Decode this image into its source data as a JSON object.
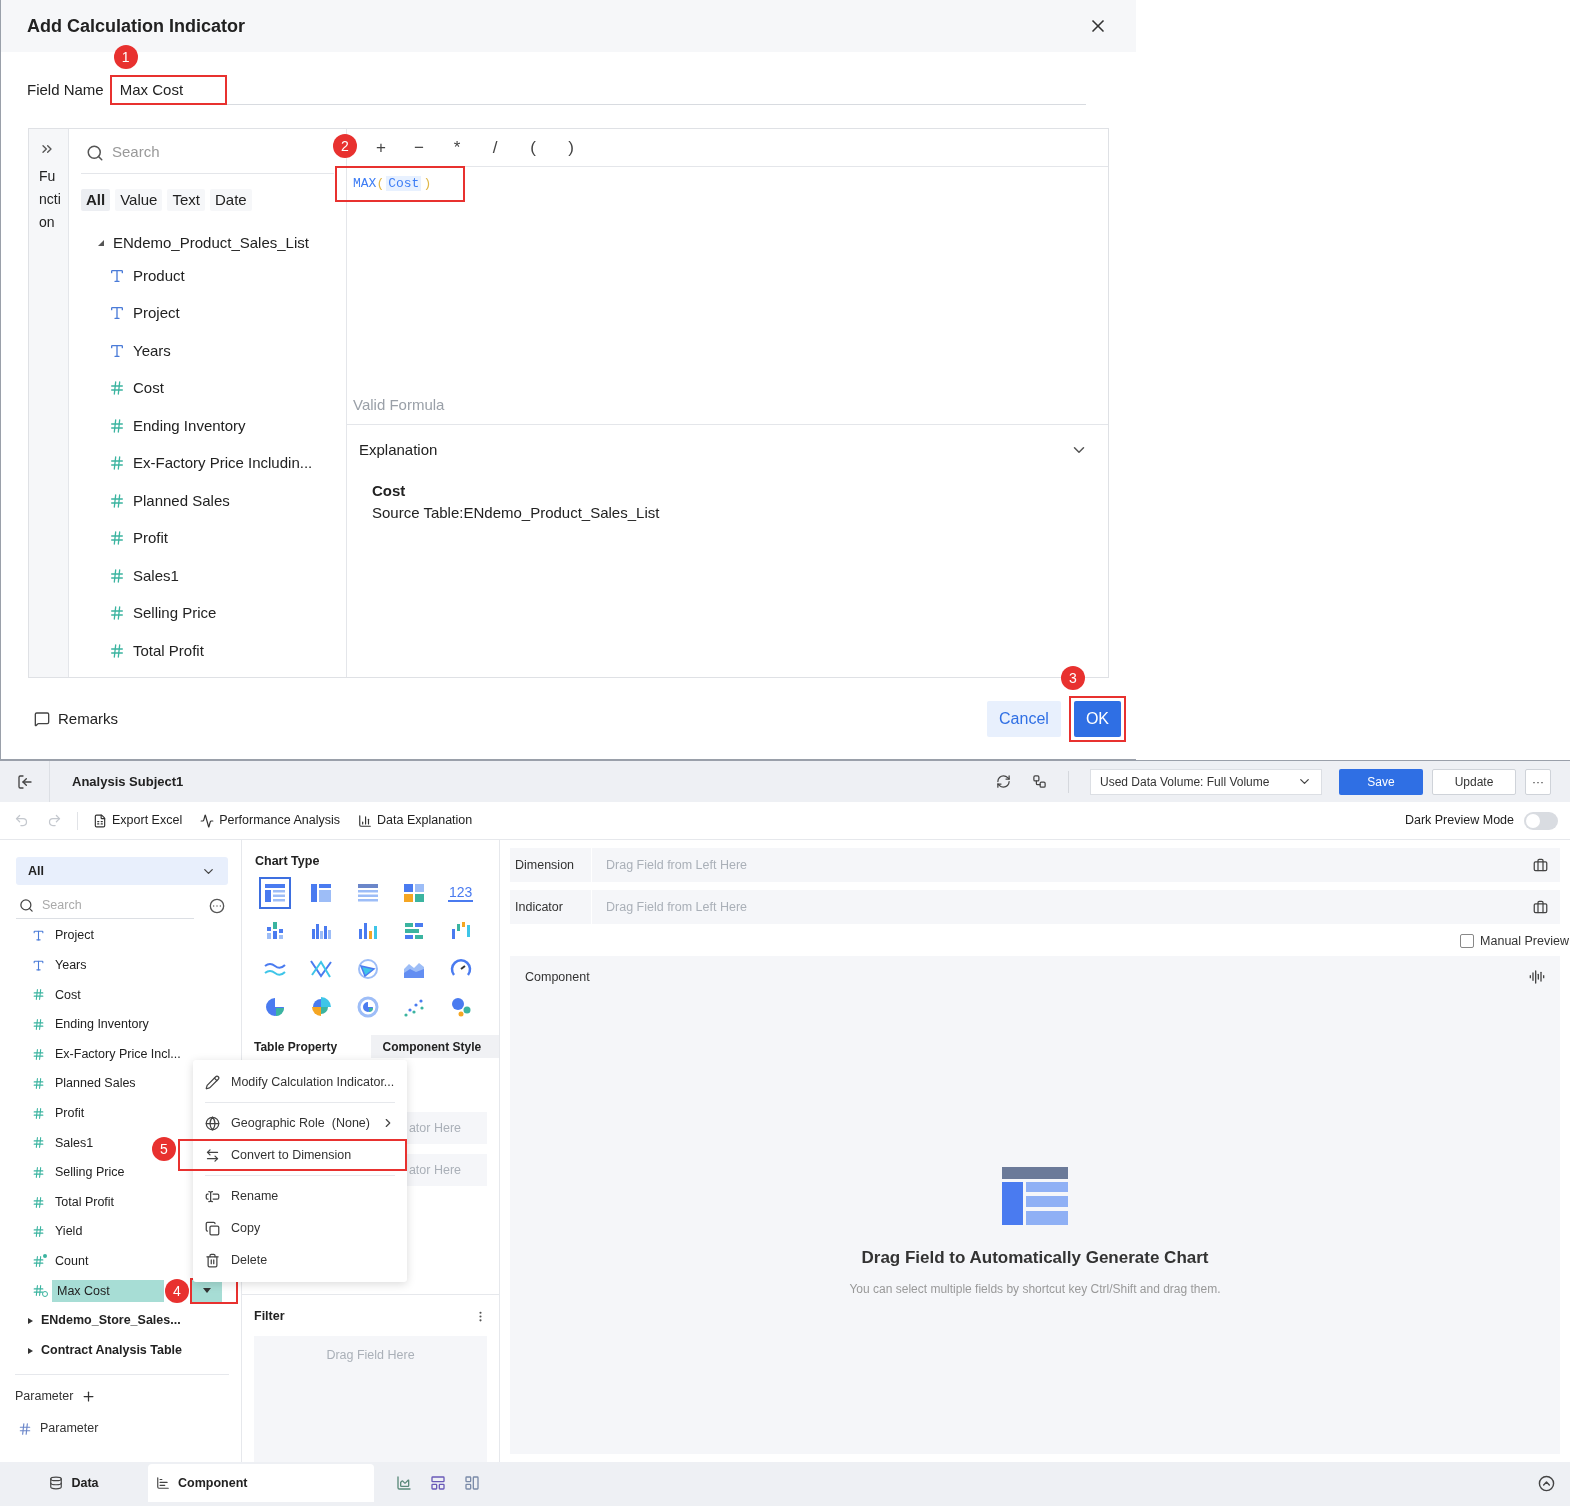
{
  "dialog": {
    "title": "Add Calculation Indicator",
    "field_name": {
      "label": "Field Name",
      "value": "Max Cost",
      "annotation": "1"
    },
    "function_tab": {
      "label": "Function"
    },
    "search": {
      "placeholder": "Search"
    },
    "filter_tabs": [
      {
        "label": "All",
        "selected": true
      },
      {
        "label": "Value",
        "selected": false
      },
      {
        "label": "Text",
        "selected": false
      },
      {
        "label": "Date",
        "selected": false
      }
    ],
    "tree": [
      {
        "label": "ENdemo_Product_Sales_List",
        "expanded": true,
        "children": [
          {
            "label": "Product",
            "kind": "text"
          },
          {
            "label": "Project",
            "kind": "text"
          },
          {
            "label": "Years",
            "kind": "text"
          },
          {
            "label": "Cost",
            "kind": "number"
          },
          {
            "label": "Ending Inventory",
            "kind": "number"
          },
          {
            "label": "Ex-Factory Price Includin...",
            "kind": "number"
          },
          {
            "label": "Planned Sales",
            "kind": "number"
          },
          {
            "label": "Profit",
            "kind": "number"
          },
          {
            "label": "Sales1",
            "kind": "number"
          },
          {
            "label": "Selling Price",
            "kind": "number"
          },
          {
            "label": "Total Profit",
            "kind": "number"
          }
        ]
      }
    ],
    "operators": [
      "+",
      "−",
      "*",
      "/",
      "(",
      ")"
    ],
    "operators_annotation": "2",
    "formula": {
      "function": "MAX",
      "open": "(",
      "field": "Cost",
      "close": ")"
    },
    "status": "Valid Formula",
    "explanation": {
      "title": "Explanation",
      "expanded": true,
      "field": "Cost",
      "source": "Source Table:ENdemo_Product_Sales_List"
    },
    "remarks": "Remarks",
    "buttons": [
      {
        "label": "Cancel",
        "kind": "secondary"
      },
      {
        "label": "OK",
        "kind": "primary",
        "annotation": "3"
      }
    ]
  },
  "app": {
    "header": {
      "title": "Analysis Subject1",
      "data_volume": "Used Data Volume: Full Volume",
      "buttons": [
        {
          "label": "Save",
          "kind": "primary"
        },
        {
          "label": "Update",
          "kind": "secondary"
        },
        {
          "label": "···",
          "kind": "more"
        }
      ]
    },
    "toolbar": [
      {
        "label": "Export Excel",
        "kind": "excel"
      },
      {
        "label": "Performance Analysis",
        "kind": "performance"
      },
      {
        "label": "Data Explanation",
        "kind": "explanation"
      }
    ],
    "dark_preview": {
      "label": "Dark Preview Mode",
      "on": false
    },
    "fields_panel": {
      "scope": "All",
      "search": {
        "placeholder": "Search"
      },
      "fields": [
        {
          "label": "Project",
          "kind": "text",
          "selected": false
        },
        {
          "label": "Years",
          "kind": "text",
          "selected": false
        },
        {
          "label": "Cost",
          "kind": "number",
          "selected": false
        },
        {
          "label": "Ending Inventory",
          "kind": "number",
          "selected": false
        },
        {
          "label": "Ex-Factory Price Incl...",
          "kind": "number",
          "selected": false
        },
        {
          "label": "Planned Sales",
          "kind": "number",
          "selected": false
        },
        {
          "label": "Profit",
          "kind": "number",
          "selected": false
        },
        {
          "label": "Sales1",
          "kind": "number",
          "selected": false
        },
        {
          "label": "Selling Price",
          "kind": "number",
          "selected": false
        },
        {
          "label": "Total Profit",
          "kind": "number",
          "selected": false
        },
        {
          "label": "Yield",
          "kind": "number",
          "selected": false
        },
        {
          "label": "Count",
          "kind": "count",
          "selected": false
        },
        {
          "label": "Max Cost",
          "kind": "calc",
          "selected": true,
          "annotation": "4"
        }
      ],
      "tables": [
        {
          "label": "ENdemo_Store_Sales...",
          "expanded": false
        },
        {
          "label": "Contract Analysis Table",
          "expanded": false
        }
      ],
      "parameter": {
        "title": "Parameter",
        "items": [
          "Parameter"
        ]
      }
    },
    "context_menu": [
      {
        "label": "Modify Calculation Indicator...",
        "kind": "edit",
        "divider_after": true,
        "submenu": false
      },
      {
        "label": "Geographic Role  (None)",
        "kind": "globe",
        "divider_after": false,
        "submenu": true
      },
      {
        "label": "Convert to Dimension",
        "kind": "convert",
        "divider_after": true,
        "submenu": false,
        "annotation": "5"
      },
      {
        "label": "Rename",
        "kind": "rename",
        "divider_after": false,
        "submenu": false
      },
      {
        "label": "Copy",
        "kind": "copy",
        "divider_after": false,
        "submenu": false
      },
      {
        "label": "Delete",
        "kind": "delete",
        "divider_after": false,
        "submenu": false
      }
    ],
    "chart_panel": {
      "title": "Chart Type",
      "types": [
        {
          "kind": "table",
          "selected": true
        },
        {
          "kind": "cross_table",
          "selected": false
        },
        {
          "kind": "detail_table",
          "selected": false
        },
        {
          "kind": "blocks",
          "selected": false
        },
        {
          "kind": "kpi",
          "label": "123",
          "selected": false
        },
        {
          "kind": "stacked_bar",
          "selected": false
        },
        {
          "kind": "grouped_bar",
          "selected": false
        },
        {
          "kind": "column",
          "selected": false
        },
        {
          "kind": "bar_table",
          "selected": false
        },
        {
          "kind": "waterfall",
          "selected": false
        },
        {
          "kind": "line",
          "selected": false
        },
        {
          "kind": "parallel",
          "selected": false
        },
        {
          "kind": "radar",
          "selected": false
        },
        {
          "kind": "area",
          "selected": false
        },
        {
          "kind": "gauge",
          "selected": false
        },
        {
          "kind": "pie",
          "selected": false
        },
        {
          "kind": "rose",
          "selected": false
        },
        {
          "kind": "ring",
          "selected": false
        },
        {
          "kind": "scatter",
          "selected": false
        },
        {
          "kind": "bubble",
          "selected": false
        }
      ]
    },
    "property_tabs": [
      {
        "label": "Table Property",
        "selected": true
      },
      {
        "label": "Component Style",
        "selected": false
      }
    ],
    "drop_zones": [
      "ator Here",
      "ator Here"
    ],
    "filter": {
      "title": "Filter",
      "placeholder": "Drag Field Here"
    },
    "shelves": [
      {
        "label": "Dimension",
        "placeholder": "Drag Field from Left Here"
      },
      {
        "label": "Indicator",
        "placeholder": "Drag Field from Left Here"
      }
    ],
    "manual_preview": {
      "label": "Manual Preview",
      "checked": false
    },
    "component": {
      "title": "Component",
      "heading": "Drag Field to Automatically Generate Chart",
      "hint": "You can select multiple fields by shortcut key Ctrl/Shift and drag them."
    },
    "bottom_tabs": [
      {
        "label": "Data",
        "kind": "data",
        "selected": false
      },
      {
        "label": "Component",
        "kind": "component",
        "selected": true
      }
    ]
  }
}
